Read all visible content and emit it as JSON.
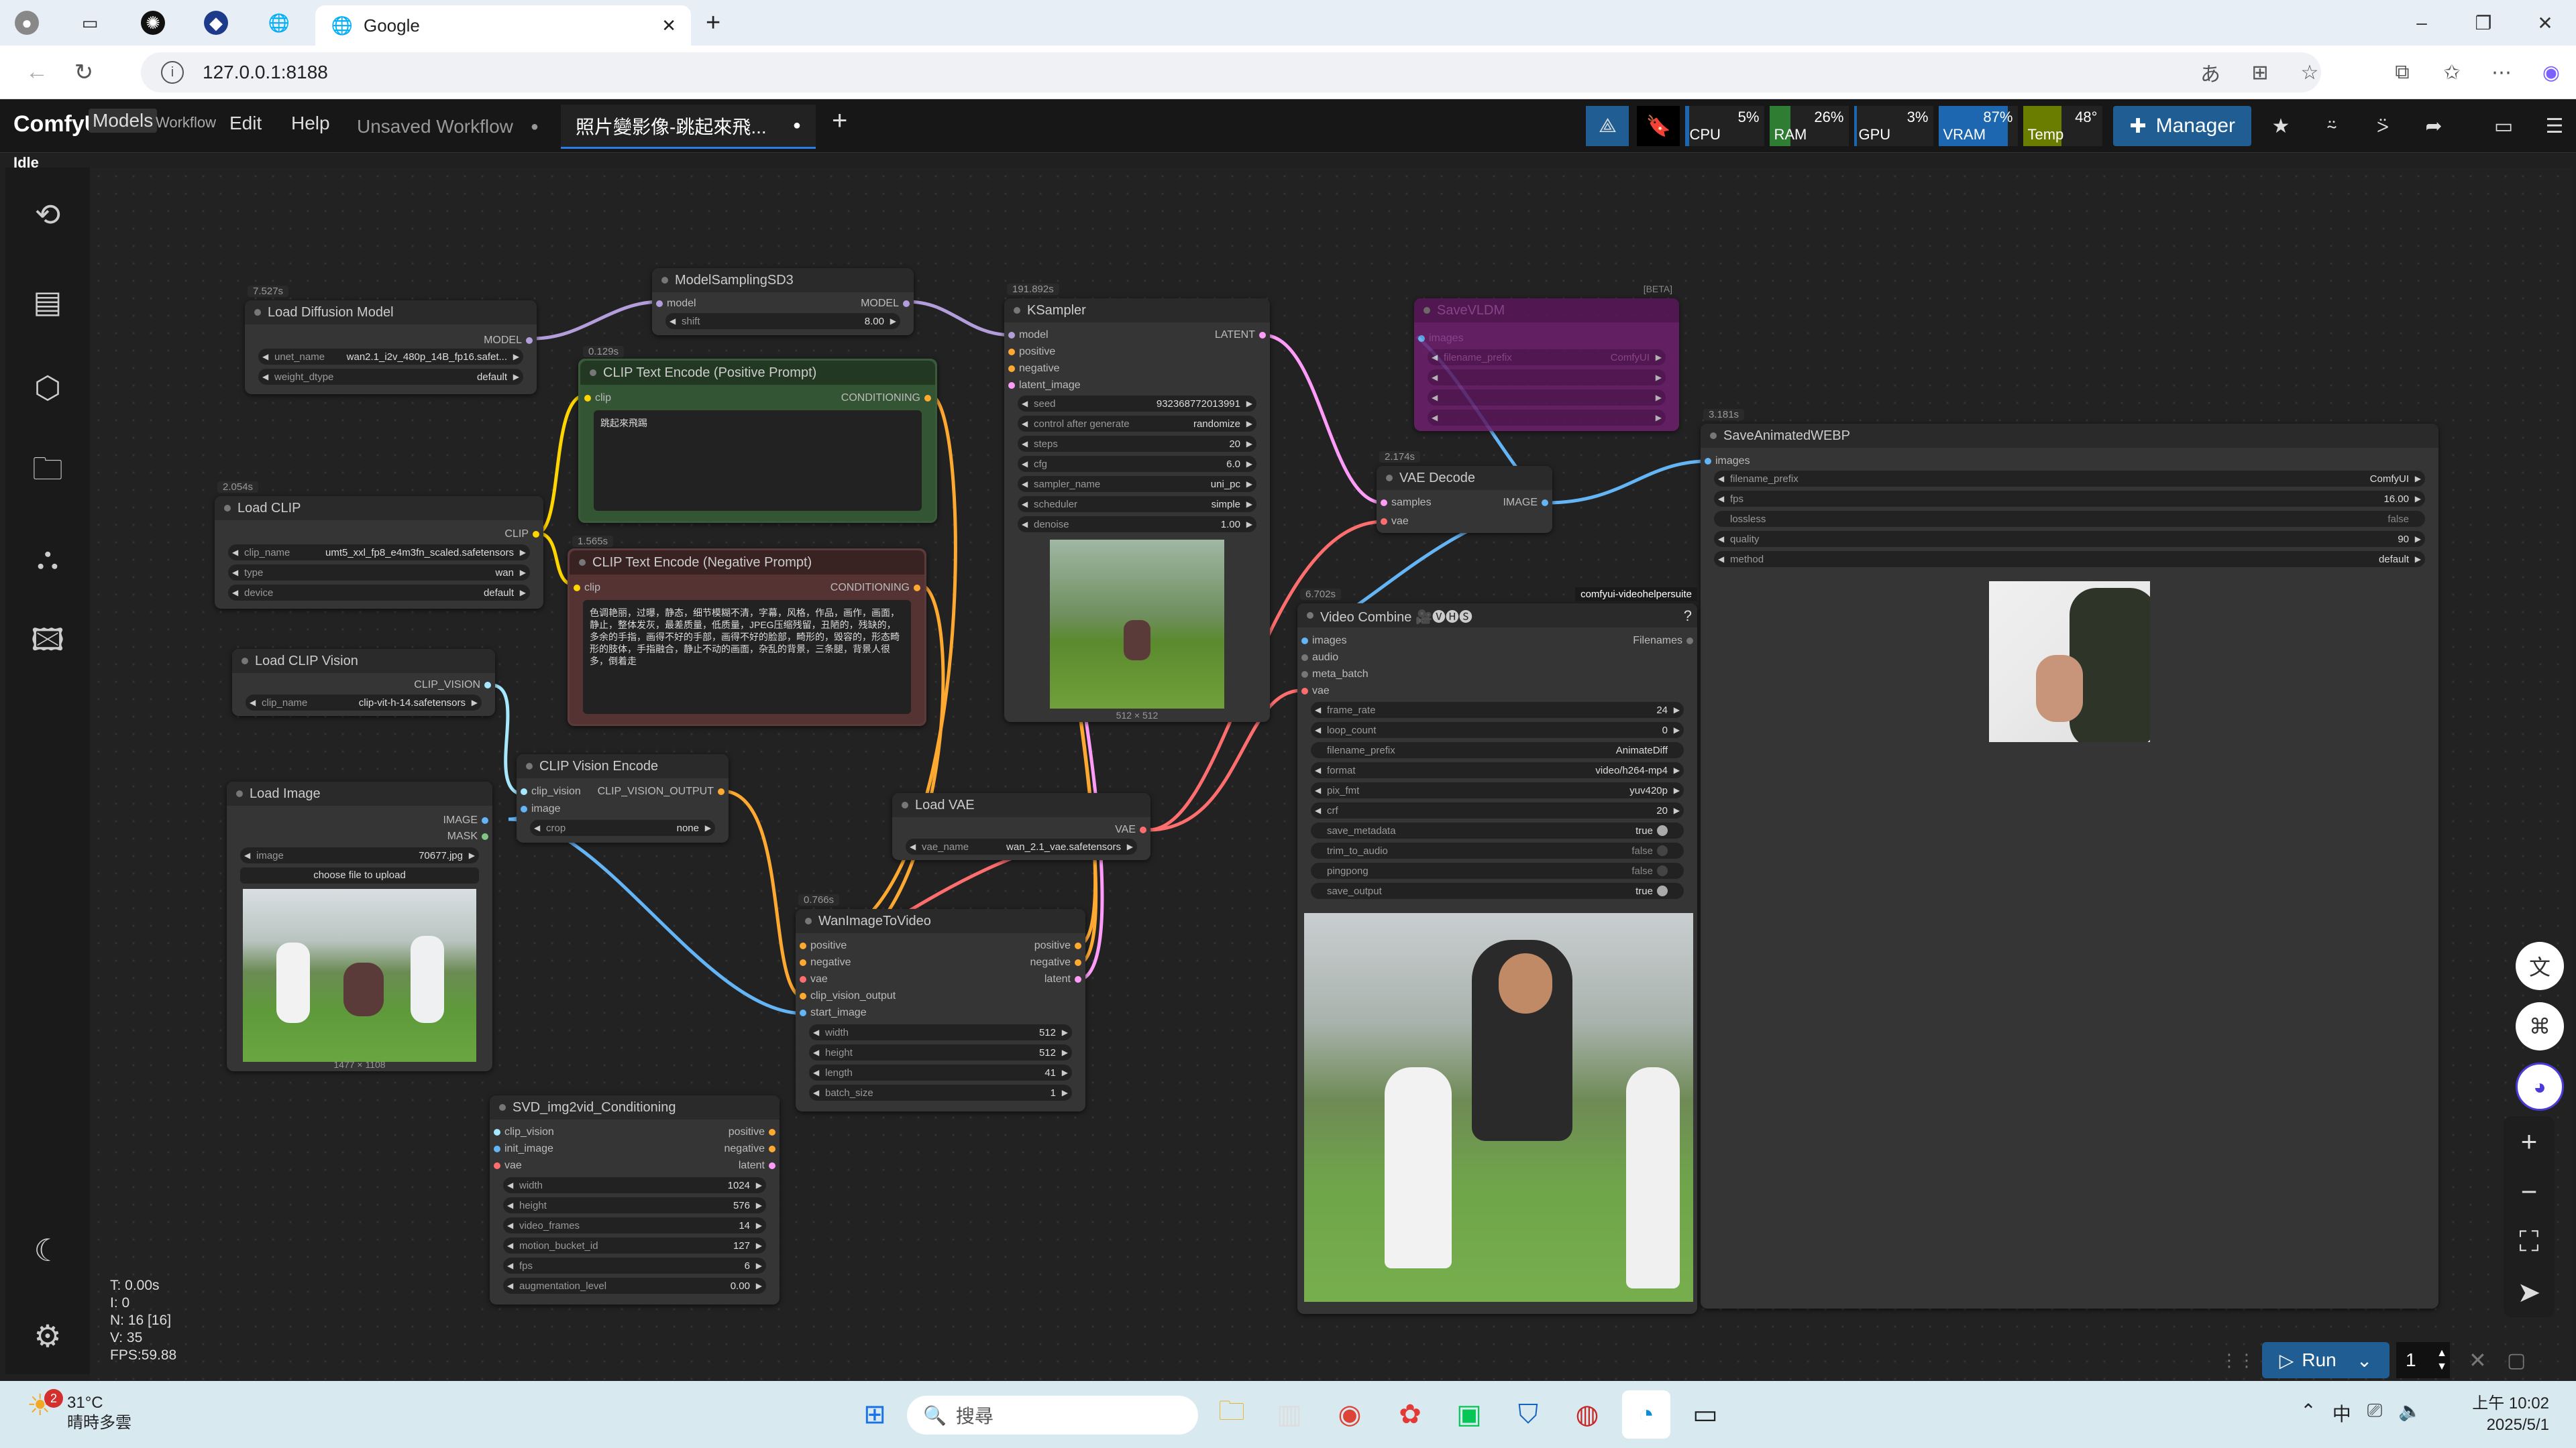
{
  "browser": {
    "tabs": [
      {
        "label": "",
        "icon": "person-icon"
      },
      {
        "label": "",
        "icon": "tab-actions-icon"
      },
      {
        "label": "",
        "icon": "openai-icon"
      },
      {
        "label": "",
        "icon": "extension-icon"
      },
      {
        "label": "",
        "icon": "globe-icon"
      },
      {
        "label": "Google",
        "icon": "globe-icon",
        "active": true
      }
    ],
    "url": "127.0.0.1:8188",
    "window_controls": [
      "–",
      "❐",
      "✕"
    ]
  },
  "app": {
    "logo": "ComfyUI",
    "menus": [
      "Models",
      "Workflow",
      "Edit",
      "Help"
    ],
    "workflow_tabs": [
      {
        "label": "Unsaved Workflow",
        "active": false
      },
      {
        "label": "照片變影像-跳起來飛...",
        "active": true
      }
    ],
    "status": "Idle",
    "monitor": [
      {
        "label": "CPU",
        "pct": "5%",
        "value": 5
      },
      {
        "label": "RAM",
        "pct": "26%",
        "value": 26
      },
      {
        "label": "GPU",
        "pct": "3%",
        "value": 3
      },
      {
        "label": "VRAM",
        "pct": "87%",
        "value": 87
      },
      {
        "label": "Temp",
        "pct": "48°",
        "value": 48
      }
    ],
    "manager_label": "Manager",
    "run_label": "Run",
    "queue_count": "1"
  },
  "stats": {
    "t": "T: 0.00s",
    "i": "I: 0",
    "n": "N: 16 [16]",
    "v": "V: 35",
    "fps": "FPS:59.88"
  },
  "nodes": {
    "load_diffusion": {
      "time": "7.527s",
      "title": "Load Diffusion Model",
      "out": "MODEL",
      "w1k": "unet_name",
      "w1v": "wan2.1_i2v_480p_14B_fp16.safet...",
      "w2k": "weight_dtype",
      "w2v": "default"
    },
    "model_sampling": {
      "title": "ModelSamplingSD3",
      "in": "model",
      "out": "MODEL",
      "wk": "shift",
      "wv": "8.00"
    },
    "clip_pos": {
      "time": "0.129s",
      "title": "CLIP Text Encode (Positive Prompt)",
      "in": "clip",
      "out": "CONDITIONING",
      "text": "跳起來飛踢"
    },
    "clip_neg": {
      "time": "1.565s",
      "title": "CLIP Text Encode (Negative Prompt)",
      "in": "clip",
      "out": "CONDITIONING",
      "text": "色调艳丽，过曝，静态，细节模糊不清，字幕，风格，作品，画作，画面，静止，整体发灰，最差质量，低质量，JPEG压缩残留，丑陋的，残缺的，多余的手指，画得不好的手部，画得不好的脸部，畸形的，毁容的，形态畸形的肢体，手指融合，静止不动的画面，杂乱的背景，三条腿，背景人很多，倒着走"
    },
    "ksampler": {
      "time": "191.892s",
      "title": "KSampler",
      "ins": [
        "model",
        "positive",
        "negative",
        "latent_image"
      ],
      "out": "LATENT",
      "widgets": [
        [
          "seed",
          "932368772013991"
        ],
        [
          "control after generate",
          "randomize"
        ],
        [
          "steps",
          "20"
        ],
        [
          "cfg",
          "6.0"
        ],
        [
          "sampler_name",
          "uni_pc"
        ],
        [
          "scheduler",
          "simple"
        ],
        [
          "denoise",
          "1.00"
        ]
      ],
      "caption": "512 × 512"
    },
    "save_bypassed": {
      "title": "SaveVLDM",
      "tag": "[BETA]",
      "in": "images",
      "wk": "filename_prefix",
      "wv": "ComfyUI"
    },
    "load_clip": {
      "time": "2.054s",
      "title": "Load CLIP",
      "out": "CLIP",
      "widgets": [
        [
          "clip_name",
          "umt5_xxl_fp8_e4m3fn_scaled.safetensors"
        ],
        [
          "type",
          "wan"
        ],
        [
          "device",
          "default"
        ]
      ]
    },
    "vae_decode": {
      "time": "2.174s",
      "title": "VAE Decode",
      "ins": [
        "samples",
        "vae"
      ],
      "out": "IMAGE"
    },
    "save_webp": {
      "time": "3.181s",
      "title": "SaveAnimatedWEBP",
      "in": "images",
      "widgets": [
        [
          "filename_prefix",
          "ComfyUI"
        ],
        [
          "fps",
          "16.00"
        ],
        [
          "lossless",
          "false"
        ],
        [
          "quality",
          "90"
        ],
        [
          "method",
          "default"
        ]
      ]
    },
    "load_clip_vision": {
      "title": "Load CLIP Vision",
      "out": "CLIP_VISION",
      "wk": "clip_name",
      "wv": "clip-vit-h-14.safetensors"
    },
    "video_combine": {
      "time": "6.702s",
      "title": "Video Combine 🎥🅥🅗🅢",
      "badge": "comfyui-videohelpersuite",
      "help": "?",
      "ins": [
        "images",
        "audio",
        "meta_batch",
        "vae"
      ],
      "out": "Filenames",
      "widgets": [
        [
          "frame_rate",
          "24"
        ],
        [
          "loop_count",
          "0"
        ],
        [
          "filename_prefix",
          "AnimateDiff"
        ],
        [
          "format",
          "video/h264-mp4"
        ],
        [
          "pix_fmt",
          "yuv420p"
        ],
        [
          "crf",
          "20"
        ]
      ],
      "toggles": [
        [
          "save_metadata",
          "true"
        ],
        [
          "trim_to_audio",
          "false"
        ],
        [
          "pingpong",
          "false"
        ],
        [
          "save_output",
          "true"
        ]
      ]
    },
    "clip_vision_encode": {
      "title": "CLIP Vision Encode",
      "ins": [
        "clip_vision",
        "image"
      ],
      "out": "CLIP_VISION_OUTPUT",
      "wk": "crop",
      "wv": "none"
    },
    "load_image": {
      "title": "Load Image",
      "outs": [
        "IMAGE",
        "MASK"
      ],
      "wk": "image",
      "wv": "70677.jpg",
      "upload": "choose file to upload",
      "caption": "1477 × 1108"
    },
    "load_vae": {
      "title": "Load VAE",
      "out": "VAE",
      "wk": "vae_name",
      "wv": "wan_2.1_vae.safetensors"
    },
    "wan_i2v": {
      "time": "0.766s",
      "title": "WanImageToVideo",
      "ins": [
        "positive",
        "negative",
        "vae",
        "clip_vision_output",
        "start_image"
      ],
      "outs": [
        "positive",
        "negative",
        "latent"
      ],
      "widgets": [
        [
          "width",
          "512"
        ],
        [
          "height",
          "512"
        ],
        [
          "length",
          "41"
        ],
        [
          "batch_size",
          "1"
        ]
      ]
    },
    "svd": {
      "title": "SVD_img2vid_Conditioning",
      "ins": [
        "clip_vision",
        "init_image",
        "vae"
      ],
      "outs": [
        "positive",
        "negative",
        "latent"
      ],
      "widgets": [
        [
          "width",
          "1024"
        ],
        [
          "height",
          "576"
        ],
        [
          "video_frames",
          "14"
        ],
        [
          "motion_bucket_id",
          "127"
        ],
        [
          "fps",
          "6"
        ],
        [
          "augmentation_level",
          "0.00"
        ]
      ]
    }
  },
  "taskbar": {
    "weather_temp": "31°C",
    "weather_desc": "晴時多雲",
    "weather_badge": "2",
    "search_placeholder": "搜尋",
    "time": "上午 10:02",
    "date": "2025/5/1",
    "ime": "中"
  },
  "colors": {
    "accent": "#1f5d93",
    "model_wire": "#b39ddb",
    "clip_wire": "#ffd500",
    "cond_wire": "#ffa931",
    "latent_wire": "#ff9cf9",
    "image_wire": "#64b5f6",
    "vae_wire": "#ff6e6e"
  }
}
